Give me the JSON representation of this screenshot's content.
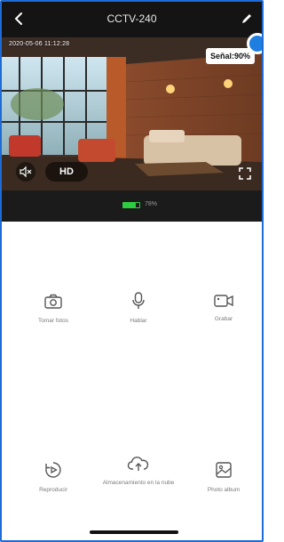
{
  "header": {
    "title": "CCTV-240"
  },
  "video": {
    "timestamp": "2020-05-06 11:12:28",
    "signal": "Señal:90%",
    "quality": "HD"
  },
  "status": {
    "battery_level": 0.78,
    "battery_text": "78%"
  },
  "actions": [
    {
      "label": "Tomar fotos",
      "icon": "camera-icon"
    },
    {
      "label": "Hablar",
      "icon": "microphone-icon"
    },
    {
      "label": "Grabar",
      "icon": "video-record-icon"
    },
    {
      "label": "Reproducir",
      "icon": "playback-icon"
    },
    {
      "label": "Almacenamiento en la nube",
      "icon": "cloud-upload-icon"
    },
    {
      "label": "Photo album",
      "icon": "photo-album-icon"
    }
  ],
  "colors": {
    "accent": "#1e6bd6",
    "battery": "#2ecc40"
  }
}
